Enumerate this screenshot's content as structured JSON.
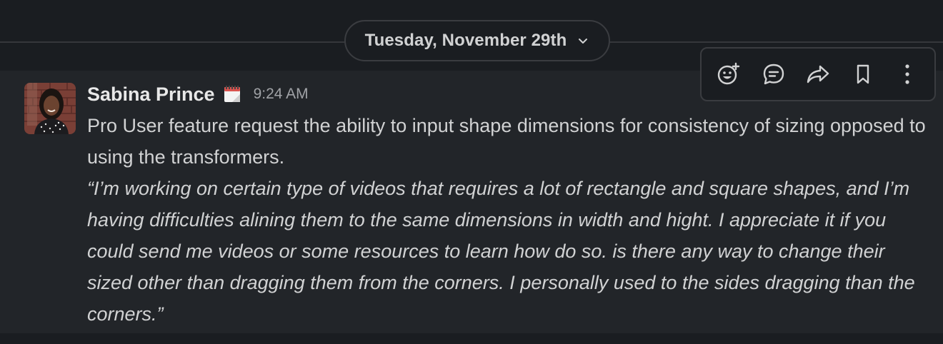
{
  "date_divider": {
    "label": "Tuesday, November 29th",
    "icon": "chevron-down-icon"
  },
  "message": {
    "sender": "Sabina Prince",
    "status_icon": "calendar-icon",
    "time": "9:24 AM",
    "text": "Pro User feature request the ability to input shape dimensions for consistency of sizing opposed to using the transformers.",
    "quote": "“I’m working on certain type of videos that requires a lot of rectangle and square shapes, and I’m having difficulties alining them to the same dimensions in width and hight. I appreciate it if you could send me videos or some resources to learn how do so. is there any way to change their sized other than dragging them from the corners. I personally used to the sides dragging than the corners.”"
  },
  "toolbar": {
    "actions": [
      {
        "icon": "add-reaction-icon"
      },
      {
        "icon": "reply-in-thread-icon"
      },
      {
        "icon": "forward-message-icon"
      },
      {
        "icon": "bookmark-icon"
      },
      {
        "icon": "more-actions-icon"
      }
    ]
  },
  "colors": {
    "background": "#1a1d21",
    "message_highlight": "#222529",
    "text": "#d1d2d3",
    "muted": "#a0a2a6",
    "border": "#3a3c40"
  }
}
